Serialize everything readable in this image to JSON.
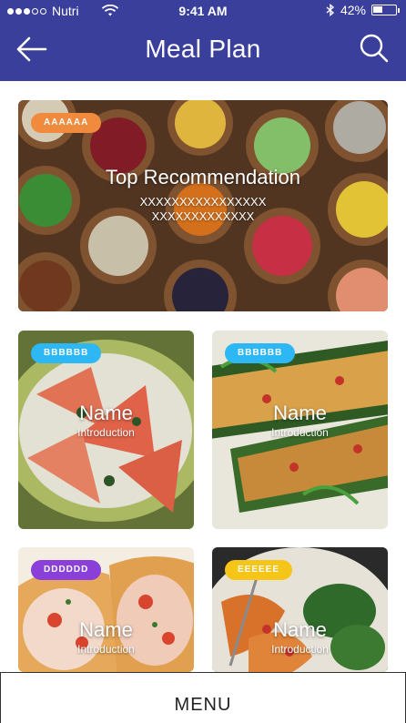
{
  "status_bar": {
    "carrier": "Nutri",
    "time": "9:41 AM",
    "battery": "42%",
    "battery_level": 0.42,
    "signal_bars_filled": 3,
    "signal_bars_total": 5
  },
  "header": {
    "title": "Meal Plan",
    "back_icon": "arrow-left-icon",
    "search_icon": "search-icon",
    "background": "#3b3f9c"
  },
  "featured": {
    "badge": "AAAAAA",
    "badge_color": "#f08a3c",
    "title": "Top Recommendation",
    "subtitle_line1": "XXXXXXXXXXXXXXXX",
    "subtitle_line2": "XXXXXXXXXXXXX"
  },
  "cards": [
    {
      "badge": "BBBBBB",
      "badge_color": "#2db7f5",
      "name": "Name",
      "intro": "Introduction"
    },
    {
      "badge": "BBBBBB",
      "badge_color": "#2db7f5",
      "name": "Name",
      "intro": "Introduction"
    },
    {
      "badge": "DDDDDD",
      "badge_color": "#8a3fd9",
      "name": "Name",
      "intro": "Introduction"
    },
    {
      "badge": "EEEEEE",
      "badge_color": "#f5c518",
      "name": "Name",
      "intro": "Introduction"
    }
  ],
  "menu": {
    "label": "MENU"
  }
}
